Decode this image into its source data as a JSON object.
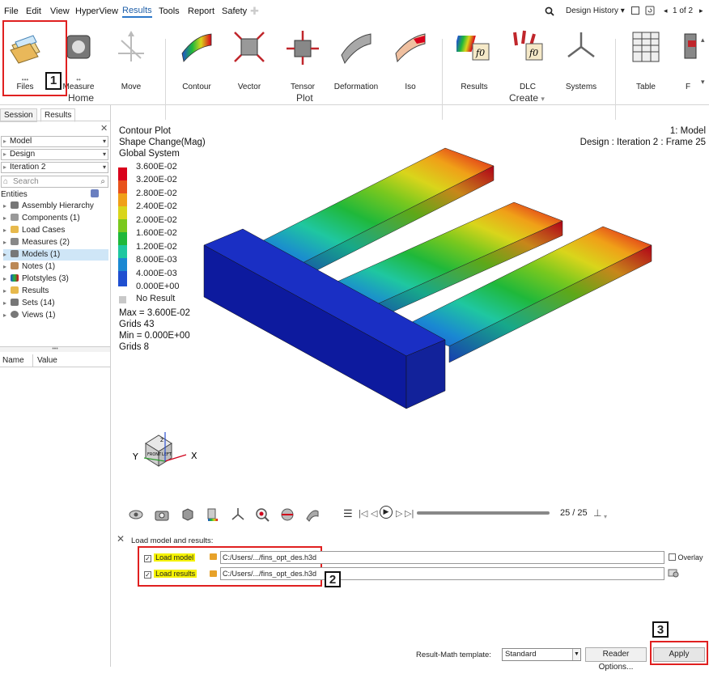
{
  "menu": {
    "items": [
      "File",
      "Edit",
      "View",
      "HyperView",
      "Results",
      "Tools",
      "Report",
      "Safety"
    ],
    "design_history": "Design History",
    "page_indicator": "1 of 2"
  },
  "ribbon": {
    "buttons": [
      "Files",
      "Measure",
      "Move",
      "Contour",
      "Vector",
      "Tensor",
      "Deformation",
      "Iso",
      "Results",
      "DLC",
      "Systems",
      "Table",
      "F"
    ],
    "groups": {
      "home": "Home",
      "plot": "Plot",
      "create": "Create"
    }
  },
  "callouts": [
    "1",
    "2",
    "3"
  ],
  "left_panel": {
    "tabs": [
      "Session",
      "Results"
    ],
    "dropdowns": [
      "Model",
      "Design",
      "Iteration 2"
    ],
    "search_placeholder": "Search",
    "entities_label": "Entities",
    "tree": [
      "Assembly Hierarchy",
      "Components (1)",
      "Load Cases",
      "Measures (2)",
      "Models (1)",
      "Notes (1)",
      "Plotstyles (3)",
      "Results",
      "Sets (14)",
      "Views (1)"
    ],
    "columns": {
      "name": "Name",
      "value": "Value"
    }
  },
  "viewport": {
    "title_lines": [
      "Contour Plot",
      "Shape Change(Mag)",
      "Global System"
    ],
    "model_label": "1: Model",
    "design_label": "Design : Iteration 2 : Frame 25",
    "legend": [
      "3.600E-02",
      "3.200E-02",
      "2.800E-02",
      "2.400E-02",
      "2.000E-02",
      "1.600E-02",
      "1.200E-02",
      "8.000E-03",
      "4.000E-03",
      "0.000E+00"
    ],
    "legend_colors": [
      "#d9001b",
      "#e8521b",
      "#f0a018",
      "#d9d51b",
      "#7ac81e",
      "#1fb83a",
      "#1fc7a0",
      "#1a88d2",
      "#1f4fd0",
      "#0d1a9e"
    ],
    "no_result": "No Result",
    "stats": [
      "Max = 3.600E-02",
      "Grids 43",
      "Min = 0.000E+00",
      "Grids 8"
    ],
    "triad": {
      "y": "Y",
      "x": "X",
      "z": "Z"
    },
    "cube_faces": [
      "FRONT",
      "LEFT"
    ]
  },
  "animation": {
    "frame": "25 / 25"
  },
  "load_panel": {
    "title": "Load model and results:",
    "load_model": "Load model",
    "load_results": "Load results",
    "model_path": "C:/Users/.../fins_opt_des.h3d",
    "results_path": "C:/Users/.../fins_opt_des.h3d",
    "overlay": "Overlay",
    "template_label": "Result-Math template:",
    "template_value": "Standard",
    "reader_options": "Reader Options...",
    "apply": "Apply"
  }
}
